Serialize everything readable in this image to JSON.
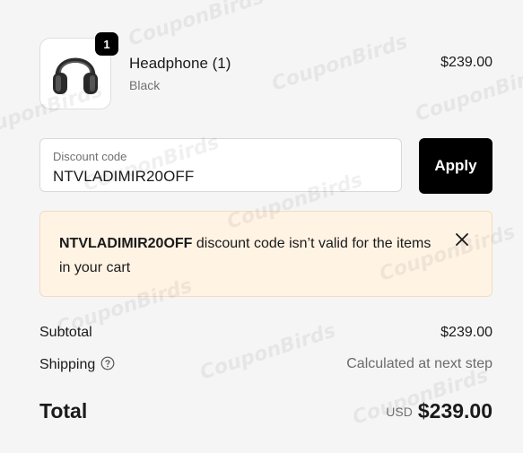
{
  "product": {
    "quantity": "1",
    "name": "Headphone (1)",
    "variant": "Black",
    "price": "$239.00",
    "image_icon": "headphones-icon"
  },
  "discount": {
    "label": "Discount code",
    "value": "NTVLADIMIR20OFF",
    "apply_label": "Apply"
  },
  "alert": {
    "code": "NTVLADIMIR20OFF",
    "message": " discount code isn’t valid for the items in your cart",
    "close_icon": "close-icon",
    "background": "#fff3e4"
  },
  "summary": {
    "subtotal_label": "Subtotal",
    "subtotal_value": "$239.00",
    "shipping_label": "Shipping",
    "shipping_value": "Calculated at next step",
    "help_icon": "help-circle-icon",
    "total_label": "Total",
    "currency": "USD",
    "total_value": "$239.00"
  },
  "watermark": "CouponBirds",
  "colors": {
    "button_bg": "#000000",
    "page_bg": "#f5f5f5"
  }
}
